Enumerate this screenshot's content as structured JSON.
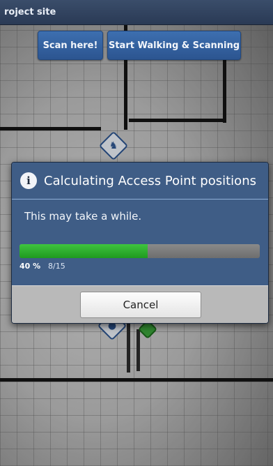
{
  "app": {
    "title": "roject site"
  },
  "toolbar": {
    "scan_label": "Scan here!",
    "walk_label": "Start Walking & Scanning"
  },
  "dialog": {
    "title": "Calculating Access Point positions",
    "message": "This may take a while.",
    "progress_percent": 40,
    "percent_label": "40 %",
    "ratio_label": "8/15",
    "cancel_label": "Cancel"
  },
  "icons": {
    "info": "info-icon",
    "footprint": "footprint-marker-icon",
    "location": "location-marker-icon"
  },
  "colors": {
    "dialog": "#3f5d86",
    "button": "#2c5590",
    "progress": "#2bb02b"
  }
}
